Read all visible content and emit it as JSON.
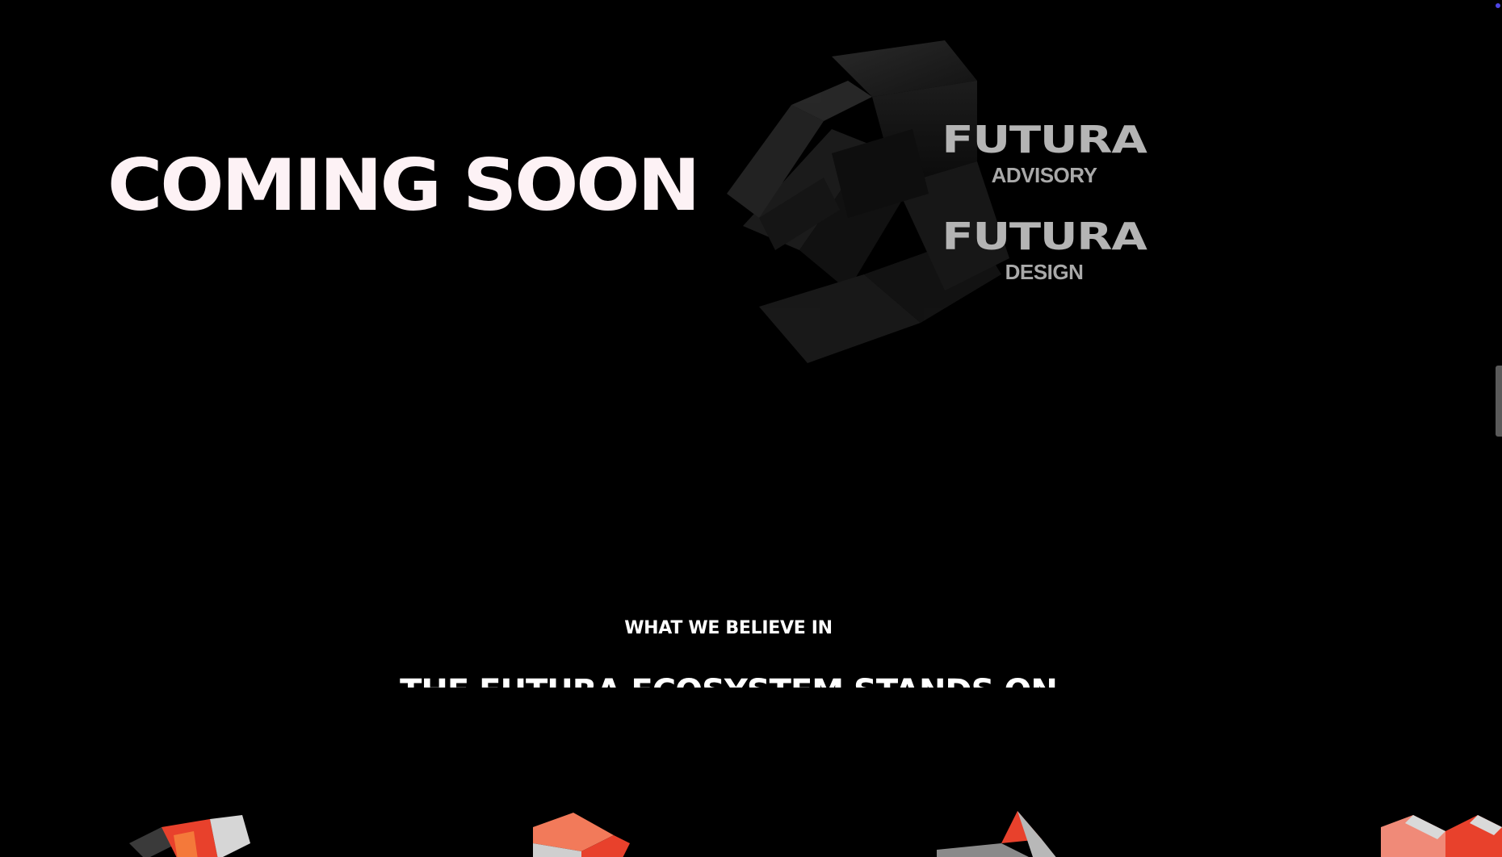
{
  "hero": {
    "title": "COMING SOON"
  },
  "brands": [
    {
      "name": "FUTURA",
      "sub": "ADVISORY"
    },
    {
      "name": "FUTURA",
      "sub": "DESIGN"
    }
  ],
  "beliefs": {
    "label": "WHAT WE BELIEVE IN",
    "title": "THE FUTURA ECOSYSTEM STANDS ON"
  },
  "icons": {
    "logo": "futura-3d-logo-icon",
    "pillars": [
      "pillar-1-icon",
      "pillar-2-icon",
      "pillar-3-icon",
      "pillar-4-icon"
    ]
  },
  "colors": {
    "background": "#000000",
    "hero_text": "#fdf2f5",
    "brand_text": "#b4b4b4",
    "accent_red": "#e8412c",
    "accent_orange": "#f4793a",
    "scroll_dot": "#4f46e5"
  }
}
